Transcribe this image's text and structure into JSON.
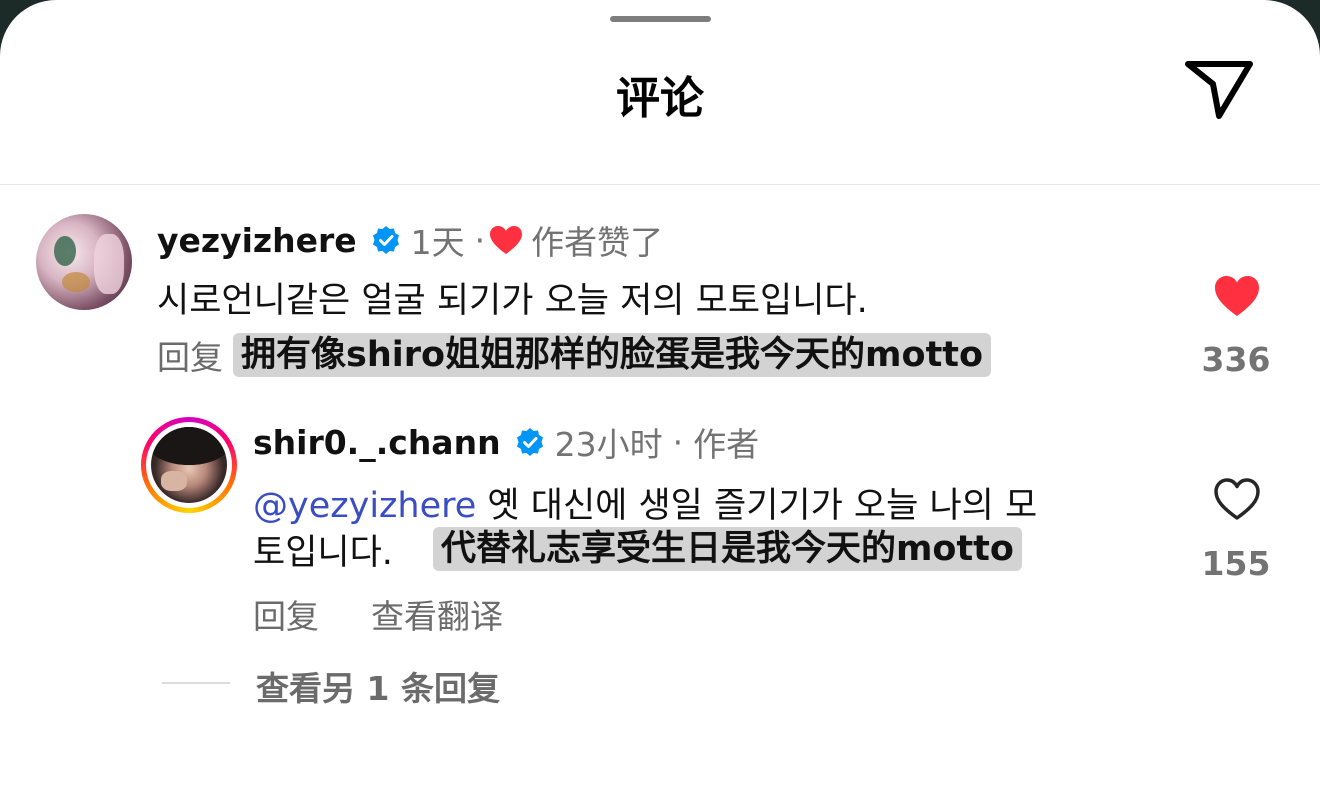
{
  "header": {
    "title": "评论",
    "share_icon": "paper-plane-icon"
  },
  "comments": [
    {
      "username": "yezyizhere",
      "verified": true,
      "time": "1天",
      "separator": "·",
      "liked_by_author_label": "作者赞了",
      "text": "시로언니같은 얼굴 되기가 오늘 저의 모토입니다.",
      "reply_label": "回复",
      "translation": "拥有像shiro姐姐那样的脸蛋是我今天的motto",
      "liked": true,
      "like_count": "336",
      "heart_color": "#ff3040"
    }
  ],
  "reply": {
    "username": "shir0._.chann",
    "verified": true,
    "time": "23小时",
    "separator": "·",
    "author_label": "作者",
    "mention": "@yezyizhere",
    "text_line1": " 옛 대신에 생일 즐기기가 오늘 나의 모",
    "text_line2": "토입니다.",
    "translation": "代替礼志享受生日是我今天的motto",
    "reply_label": "回复",
    "translate_label": "查看翻译",
    "liked": false,
    "like_count": "155"
  },
  "more_replies_label": "查看另 1 条回复",
  "colors": {
    "verified_badge": "#0095f6",
    "mention": "#3a4dc2",
    "like_red": "#ff3040"
  }
}
